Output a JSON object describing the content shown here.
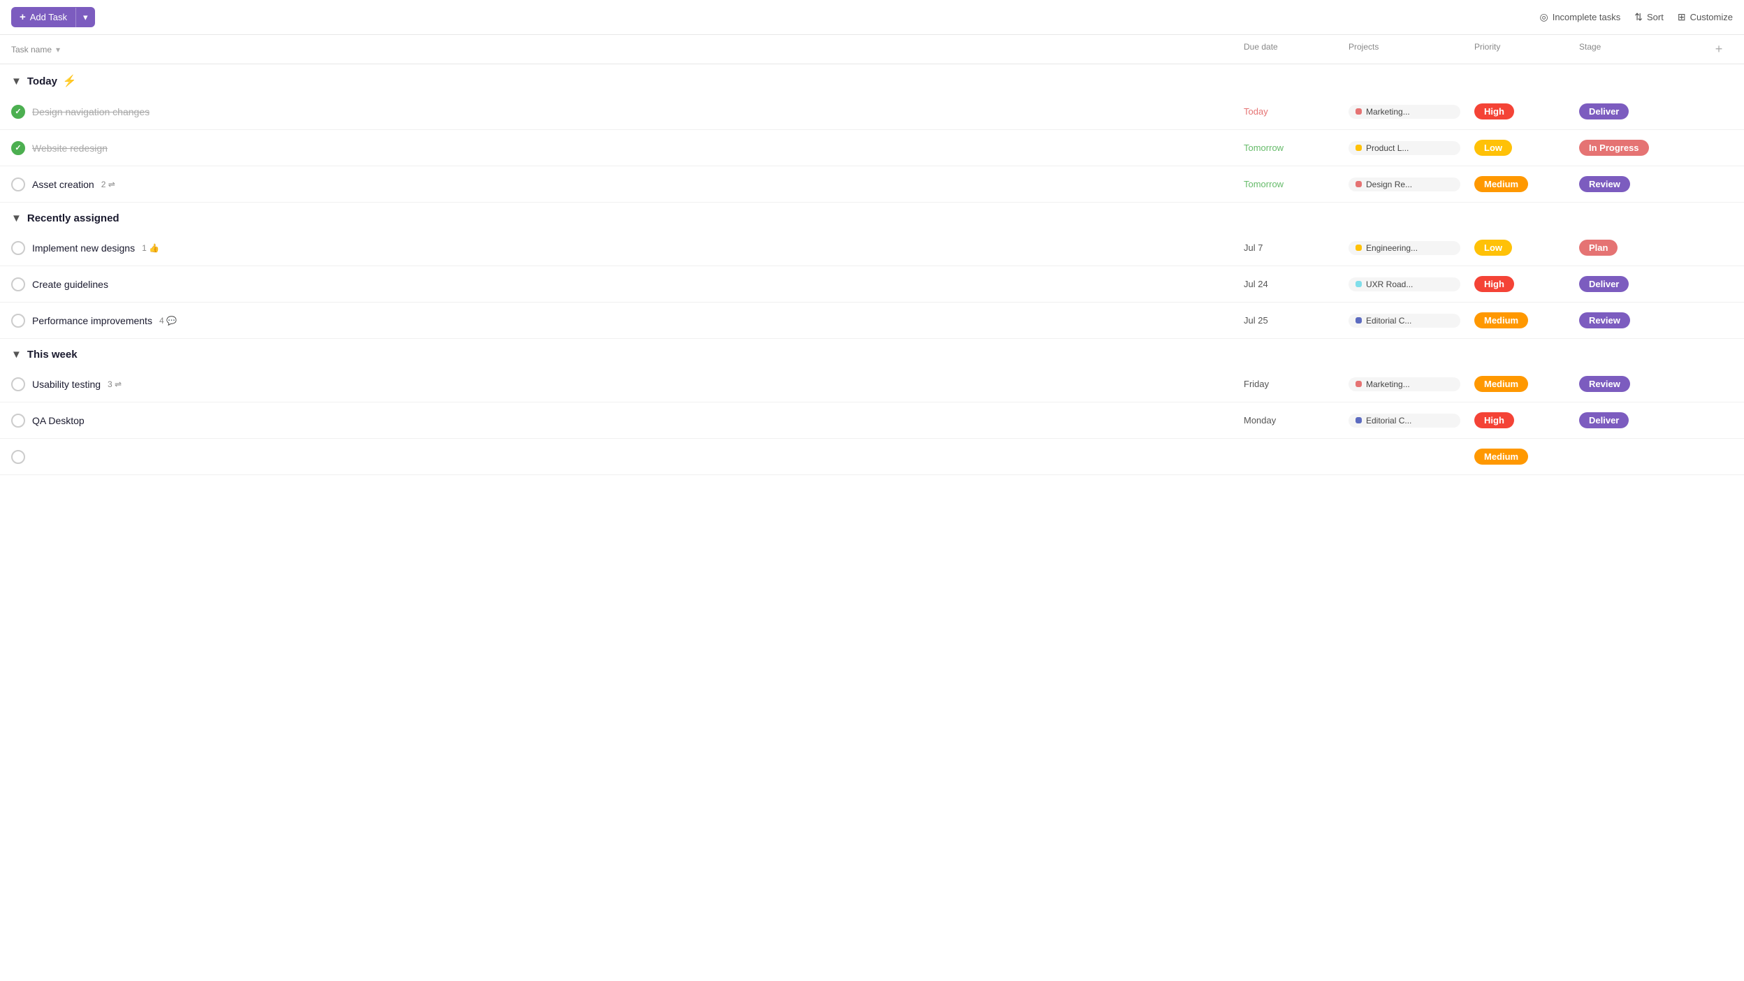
{
  "toolbar": {
    "add_task_label": "+ Add Task",
    "dropdown_icon": "▾",
    "incomplete_tasks_label": "Incomplete tasks",
    "sort_label": "Sort",
    "customize_label": "Customize"
  },
  "table_header": {
    "task_name": "Task name",
    "due_date": "Due date",
    "projects": "Projects",
    "priority": "Priority",
    "stage": "Stage",
    "add_col": "+"
  },
  "sections": [
    {
      "id": "today",
      "label": "Today",
      "has_lightning": true,
      "tasks": [
        {
          "id": "t1",
          "name": "Design navigation changes",
          "completed": true,
          "due_date": "Today",
          "due_class": "due-today",
          "project_name": "Marketing...",
          "project_color": "#e57373",
          "priority": "High",
          "priority_class": "priority-high",
          "stage": "Deliver",
          "stage_class": "stage-deliver",
          "meta": []
        },
        {
          "id": "t2",
          "name": "Website redesign",
          "completed": true,
          "due_date": "Tomorrow",
          "due_class": "due-soon",
          "project_name": "Product L...",
          "project_color": "#ffc107",
          "priority": "Low",
          "priority_class": "priority-low",
          "stage": "In Progress",
          "stage_class": "stage-in-progress",
          "meta": []
        },
        {
          "id": "t3",
          "name": "Asset creation",
          "completed": false,
          "due_date": "Tomorrow",
          "due_class": "due-soon",
          "project_name": "Design Re...",
          "project_color": "#e57373",
          "priority": "Medium",
          "priority_class": "priority-medium",
          "stage": "Review",
          "stage_class": "stage-review",
          "meta": [
            {
              "type": "subtasks",
              "count": "2"
            }
          ]
        }
      ]
    },
    {
      "id": "recently-assigned",
      "label": "Recently assigned",
      "has_lightning": false,
      "tasks": [
        {
          "id": "t4",
          "name": "Implement new designs",
          "completed": false,
          "due_date": "Jul 7",
          "due_class": "due-normal",
          "project_name": "Engineering...",
          "project_color": "#ffc107",
          "priority": "Low",
          "priority_class": "priority-low",
          "stage": "Plan",
          "stage_class": "stage-plan",
          "meta": [
            {
              "type": "likes",
              "count": "1"
            }
          ]
        },
        {
          "id": "t5",
          "name": "Create guidelines",
          "completed": false,
          "due_date": "Jul 24",
          "due_class": "due-normal",
          "project_name": "UXR Road...",
          "project_color": "#80deea",
          "priority": "High",
          "priority_class": "priority-high",
          "stage": "Deliver",
          "stage_class": "stage-deliver",
          "meta": []
        },
        {
          "id": "t6",
          "name": "Performance improvements",
          "completed": false,
          "due_date": "Jul 25",
          "due_class": "due-normal",
          "project_name": "Editorial C...",
          "project_color": "#5c6bc0",
          "priority": "Medium",
          "priority_class": "priority-medium",
          "stage": "Review",
          "stage_class": "stage-review",
          "meta": [
            {
              "type": "comments",
              "count": "4"
            }
          ]
        }
      ]
    },
    {
      "id": "this-week",
      "label": "This week",
      "has_lightning": false,
      "tasks": [
        {
          "id": "t7",
          "name": "Usability testing",
          "completed": false,
          "due_date": "Friday",
          "due_class": "due-normal",
          "project_name": "Marketing...",
          "project_color": "#e57373",
          "priority": "Medium",
          "priority_class": "priority-medium",
          "stage": "Review",
          "stage_class": "stage-review",
          "meta": [
            {
              "type": "subtasks",
              "count": "3"
            }
          ]
        },
        {
          "id": "t8",
          "name": "QA Desktop",
          "completed": false,
          "due_date": "Monday",
          "due_class": "due-normal",
          "project_name": "Editorial C...",
          "project_color": "#5c6bc0",
          "priority": "High",
          "priority_class": "priority-high",
          "stage": "Deliver",
          "stage_class": "stage-deliver",
          "meta": []
        },
        {
          "id": "t9",
          "name": "...",
          "completed": false,
          "due_date": "",
          "due_class": "due-normal",
          "project_name": "",
          "project_color": "#ccc",
          "priority": "Medium",
          "priority_class": "priority-medium",
          "stage": "",
          "stage_class": "stage-plan",
          "meta": []
        }
      ]
    }
  ]
}
